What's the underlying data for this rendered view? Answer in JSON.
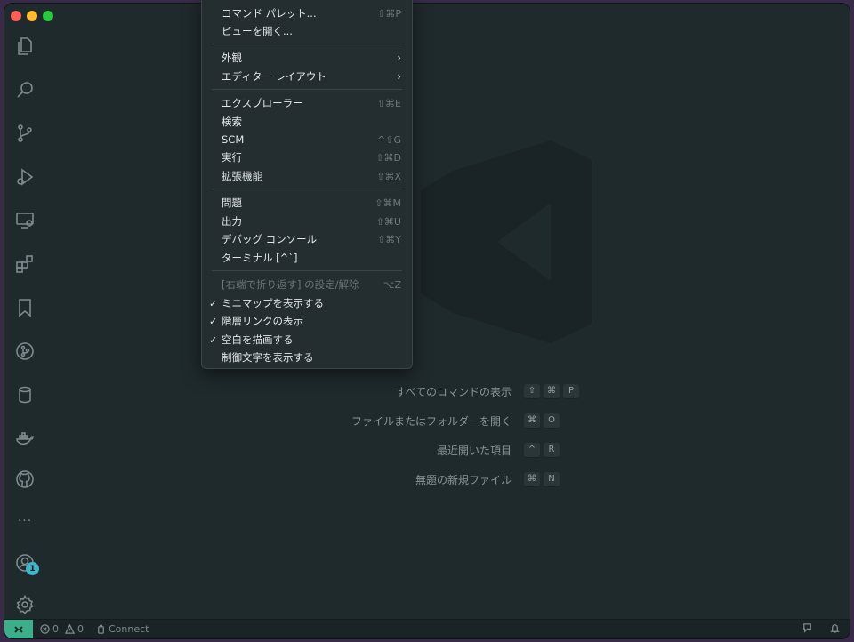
{
  "menu": {
    "items": [
      {
        "label": "コマンド パレット...",
        "shortcut": "⇧⌘P"
      },
      {
        "label": "ビューを開く..."
      },
      {
        "label": "外観",
        "arrow": "›"
      },
      {
        "label": "エディター レイアウト",
        "arrow": "›"
      },
      {
        "label": "エクスプローラー",
        "shortcut": "⇧⌘E"
      },
      {
        "label": "検索"
      },
      {
        "label": "SCM",
        "shortcut": "^⇧G"
      },
      {
        "label": "実行",
        "shortcut": "⇧⌘D"
      },
      {
        "label": "拡張機能",
        "shortcut": "⇧⌘X"
      },
      {
        "label": "問題",
        "shortcut": "⇧⌘M"
      },
      {
        "label": "出力",
        "shortcut": "⇧⌘U"
      },
      {
        "label": "デバッグ コンソール",
        "shortcut": "⇧⌘Y"
      },
      {
        "label": "ターミナル [^`]"
      },
      {
        "label": "[右端で折り返す] の設定/解除",
        "shortcut": "⌥Z",
        "disabled": true
      },
      {
        "label": "ミニマップを表示する",
        "checked": true
      },
      {
        "label": "階層リンクの表示",
        "checked": true
      },
      {
        "label": "空白を描画する",
        "checked": true
      },
      {
        "label": "制御文字を表示する"
      }
    ],
    "check_glyph": "✓"
  },
  "welcome": {
    "shortcuts": [
      {
        "label": "すべてのコマンドの表示",
        "keys": [
          "⇧",
          "⌘",
          "P"
        ]
      },
      {
        "label": "ファイルまたはフォルダーを開く",
        "keys": [
          "⌘",
          "O"
        ]
      },
      {
        "label": "最近開いた項目",
        "keys": [
          "^",
          "R"
        ]
      },
      {
        "label": "無題の新規ファイル",
        "keys": [
          "⌘",
          "N"
        ]
      }
    ]
  },
  "activity_bar": {
    "accounts_badge": "1",
    "more_label": "···"
  },
  "status_bar": {
    "errors": "0",
    "warnings": "0",
    "connect_label": "Connect"
  },
  "colors": {
    "background": "#1f2a2d",
    "menu_bg": "#242e31",
    "remote_accent": "#3ab08a",
    "badge": "#3fb5c8"
  }
}
